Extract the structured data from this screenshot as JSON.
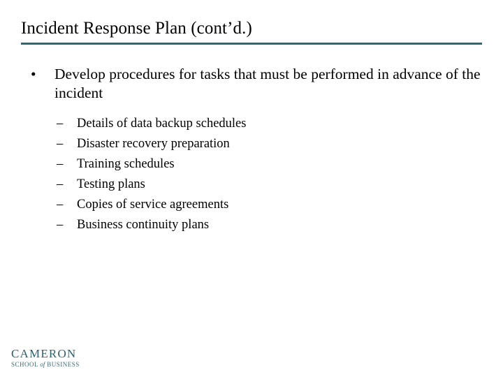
{
  "slide": {
    "title": "Incident Response Plan (cont’d.)",
    "accent_color": "#2c6a72",
    "background_color": "#ffffff",
    "text_color": "#000000",
    "rule": {
      "name": "title-underline-rule",
      "color": "#2c6a72"
    },
    "bullets": [
      {
        "marker": "•",
        "text": "Develop procedures for tasks that must be performed in advance of the incident",
        "level": 1
      }
    ],
    "sub_bullets": [
      {
        "marker": "–",
        "text": "Details of data backup schedules"
      },
      {
        "marker": "–",
        "text": "Disaster recovery preparation"
      },
      {
        "marker": "–",
        "text": "Training schedules"
      },
      {
        "marker": "–",
        "text": "Testing plans"
      },
      {
        "marker": "–",
        "text": "Copies of service agreements"
      },
      {
        "marker": "–",
        "text": "Business continuity plans"
      }
    ],
    "logo": {
      "primary": "CAMERON",
      "secondary_prefix": "SCHOOL",
      "secondary_conjunction": "of",
      "secondary_suffix": "BUSINESS",
      "color": "#2f616a"
    }
  }
}
